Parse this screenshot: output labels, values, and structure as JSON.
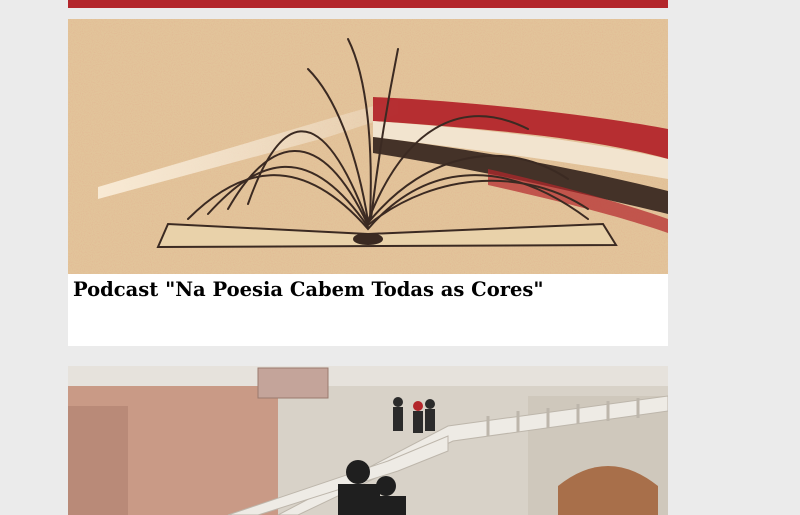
{
  "articles": [
    {
      "title": "Podcast \"Na Poesia Cabem Todas as Cores\"",
      "image_icon": "open-book-illustration",
      "colors": {
        "background": "#e2c49a",
        "accent_red": "#b3262b",
        "ink": "#3b2a22"
      }
    },
    {
      "title": "",
      "image_icon": "photo-staircase-students",
      "colors": {
        "stone": "#d8d2c8",
        "marble": "#c99a86"
      }
    }
  ],
  "colors": {
    "page_bg": "#ebebeb",
    "accent": "#b3262b",
    "card_bg": "#ffffff"
  }
}
